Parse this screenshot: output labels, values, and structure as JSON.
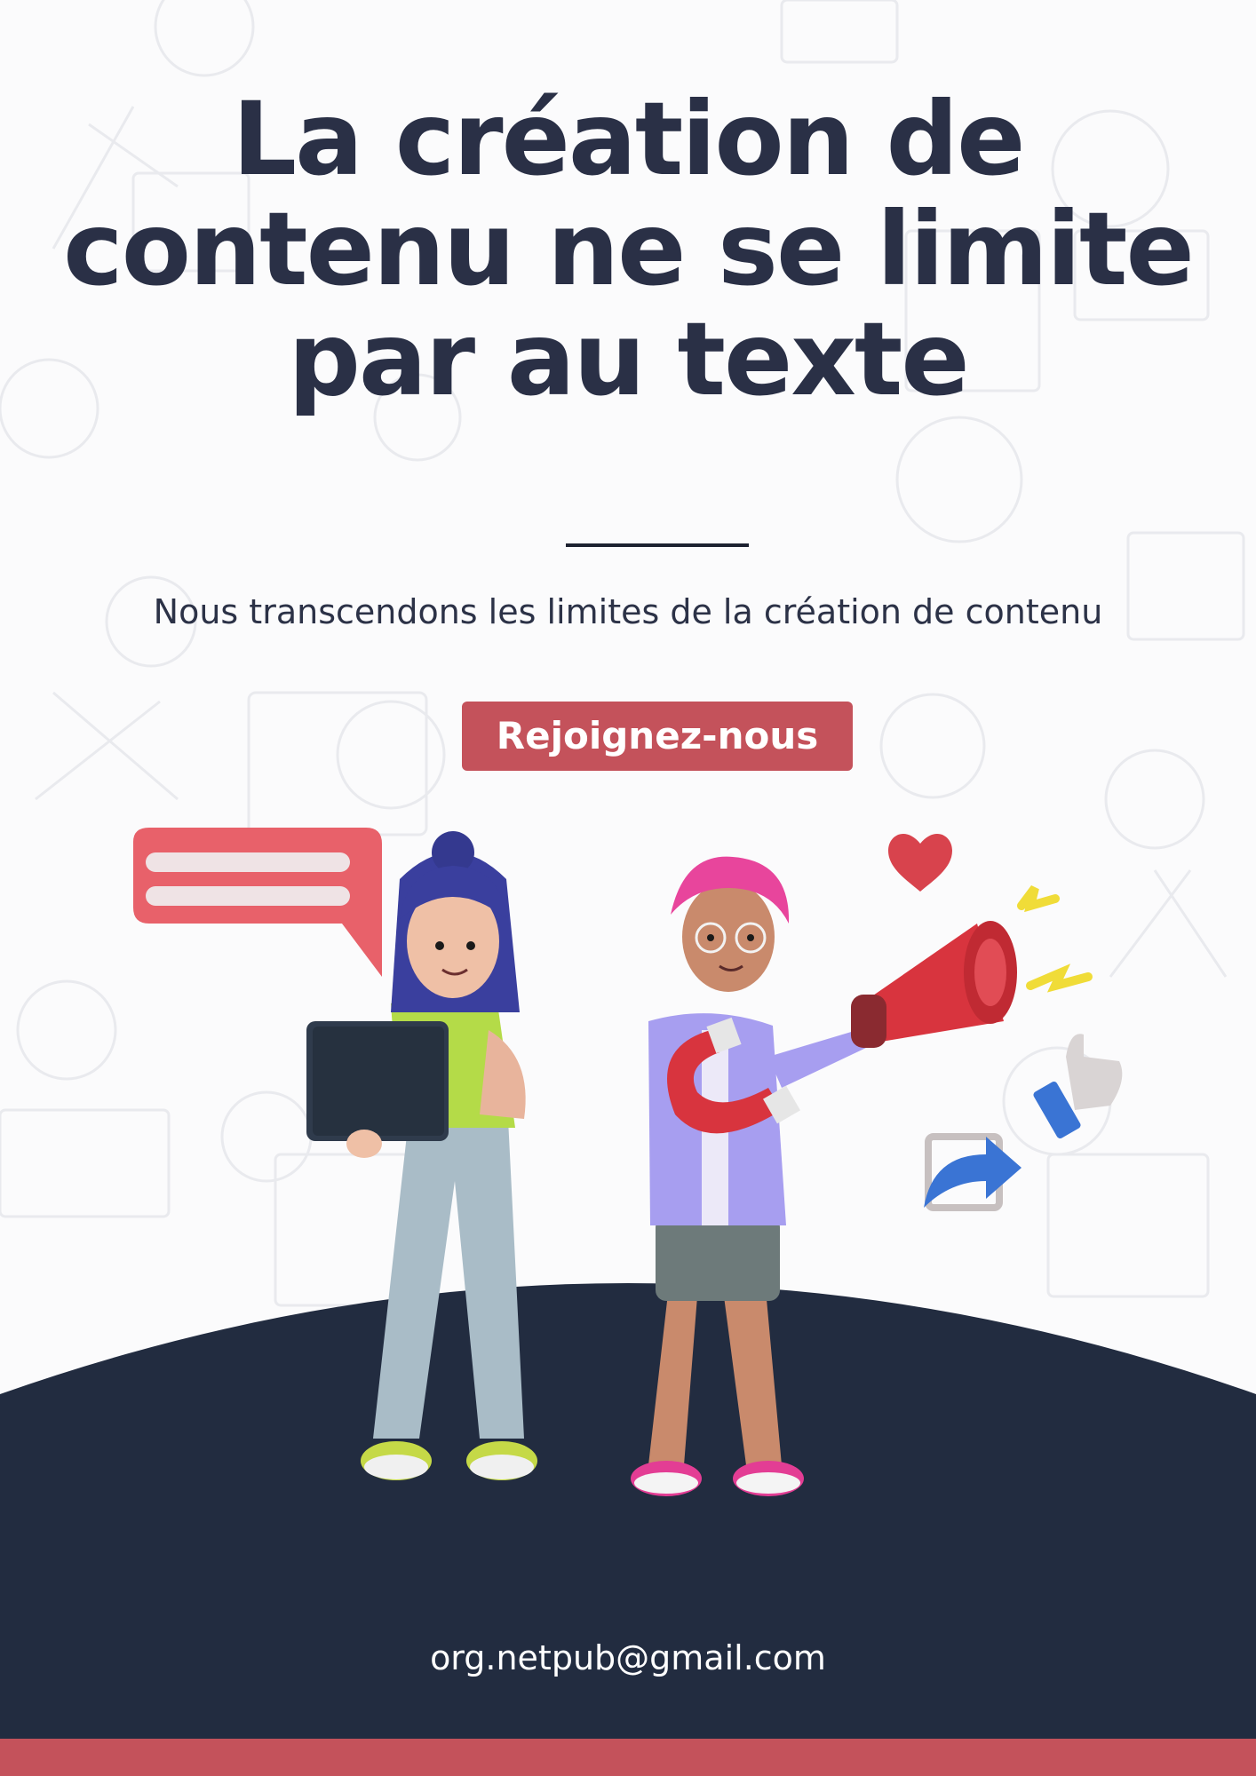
{
  "poster": {
    "headline": "La création de contenu ne se limite par au texte",
    "subtitle": "Nous transcendons les limites de la création de contenu",
    "cta_label": "Rejoignez-nous",
    "email": "org.netpub@gmail.com"
  },
  "colors": {
    "heading": "#2a3046",
    "accent": "#c4525b",
    "navy": "#222c40",
    "background": "#fbfbfc"
  },
  "illustration": {
    "characters": [
      "woman-with-laptop",
      "woman-with-magnet-and-megaphone"
    ],
    "icons": [
      "speech-bubble-icon",
      "heart-icon",
      "megaphone-icon",
      "magnet-icon",
      "thumbs-up-icon",
      "share-icon",
      "laptop-icon"
    ]
  }
}
